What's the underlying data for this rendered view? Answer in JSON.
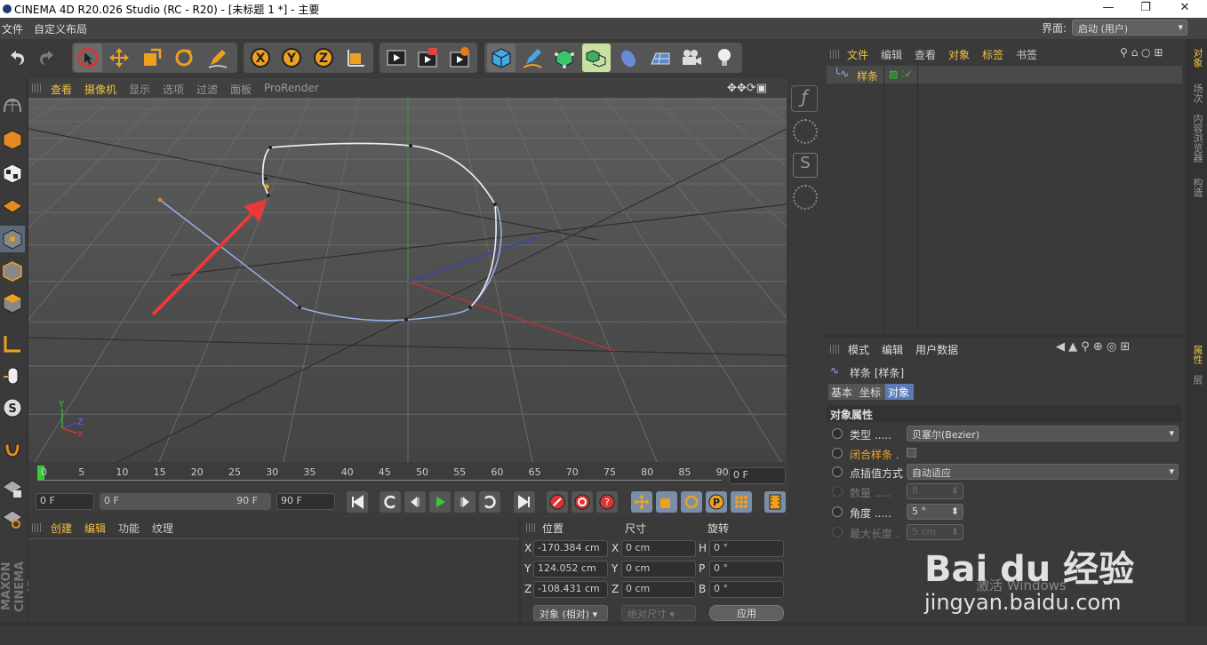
{
  "window": {
    "title": "CINEMA 4D R20.026 Studio (RC - R20) - [未标题 1 *] - 主要",
    "min": "—",
    "max": "❐",
    "close": "✕"
  },
  "menubar": {
    "items": [
      "文件",
      "自定义布局"
    ],
    "layout_label": "界面:",
    "layout_value": "启动 (用户)"
  },
  "viewport": {
    "menu": [
      "查看",
      "摄像机",
      "显示",
      "选项",
      "过滤",
      "面板",
      "ProRender"
    ],
    "axis": {
      "y": "Y",
      "z": "Z",
      "x": "X"
    }
  },
  "timeline": {
    "ticks": [
      "0",
      "5",
      "10",
      "15",
      "20",
      "25",
      "30",
      "35",
      "40",
      "45",
      "50",
      "55",
      "60",
      "65",
      "70",
      "75",
      "80",
      "85",
      "90"
    ],
    "current": "0 F"
  },
  "transport": {
    "start": "0 F",
    "range_start": "0 F",
    "range_end": "90 F",
    "end": "90 F"
  },
  "materials": {
    "menu": [
      "创建",
      "编辑",
      "功能",
      "纹理"
    ]
  },
  "coords": {
    "headers": [
      "位置",
      "尺寸",
      "旋转"
    ],
    "rows": [
      {
        "axis": "X",
        "pos": "-170.384 cm",
        "saxis": "X",
        "size": "0 cm",
        "raxis": "H",
        "rot": "0 °"
      },
      {
        "axis": "Y",
        "pos": "124.052 cm",
        "saxis": "Y",
        "size": "0 cm",
        "raxis": "P",
        "rot": "0 °"
      },
      {
        "axis": "Z",
        "pos": "-108.431 cm",
        "saxis": "Z",
        "size": "0 cm",
        "raxis": "B",
        "rot": "0 °"
      }
    ],
    "mode": "对象 (相对)",
    "sizemode": "绝对尺寸",
    "apply": "应用"
  },
  "objects": {
    "menu": [
      "文件",
      "编辑",
      "查看",
      "对象",
      "标签",
      "书签"
    ],
    "item": "样条"
  },
  "attributes": {
    "menu": [
      "模式",
      "编辑",
      "用户数据"
    ],
    "object": "样条 [样条]",
    "tabs": [
      "基本",
      "坐标",
      "对象"
    ],
    "section": "对象属性",
    "rows": [
      {
        "label": "类型 .....",
        "value": "贝塞尔(Bezier)"
      },
      {
        "label": "闭合样条 .",
        "value": ""
      },
      {
        "label": "点插值方式",
        "value": "自动适应"
      },
      {
        "label": "数量 .....",
        "value": "8"
      },
      {
        "label": "角度 .....",
        "value": "5 °"
      },
      {
        "label": "最大长度 .",
        "value": "5 cm"
      }
    ]
  },
  "righttabs": [
    "对象",
    "场次",
    "内容浏览器",
    "构造",
    "属性",
    "层"
  ],
  "watermark": {
    "brand": "Bai du 经验",
    "url": "jingyan.baidu.com",
    "activate": "激活 Windows"
  },
  "sidebrand": "MAXON CINEMA 4D"
}
